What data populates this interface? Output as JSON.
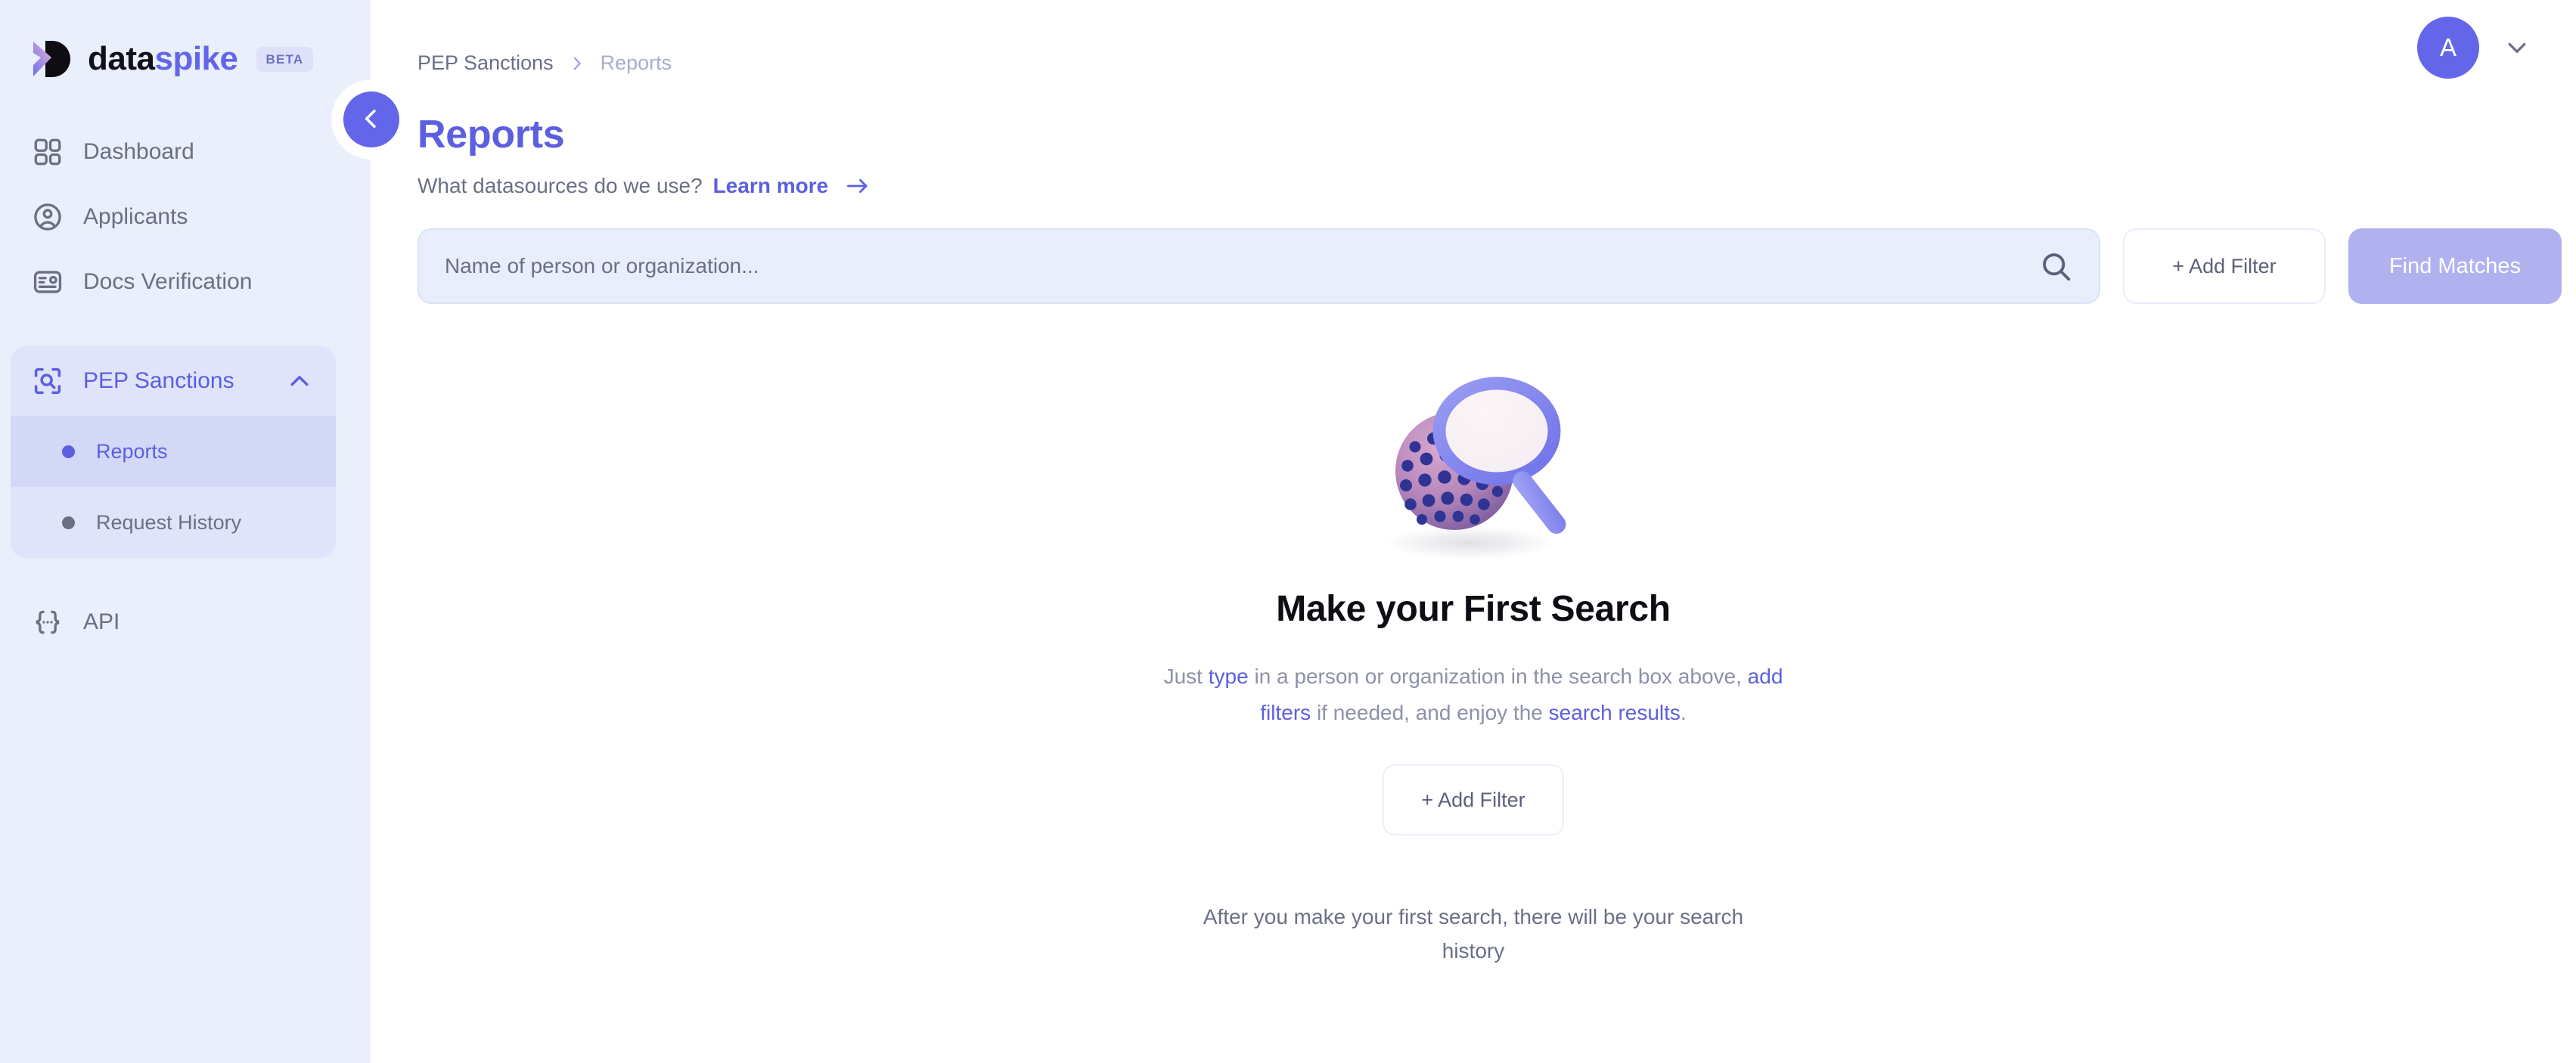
{
  "brand": {
    "name_part1": "data",
    "name_part2": "spike",
    "badge": "BETA",
    "accent": "#6366e8",
    "sidebar_bg": "#e9effb"
  },
  "sidebar": {
    "items": [
      {
        "label": "Dashboard",
        "icon": "grid-icon"
      },
      {
        "label": "Applicants",
        "icon": "user-circle-icon"
      },
      {
        "label": "Docs Verification",
        "icon": "id-card-icon"
      }
    ],
    "group": {
      "label": "PEP Sanctions",
      "icon": "scan-search-icon",
      "chevron": "chevron-up-icon",
      "expanded": true,
      "children": [
        {
          "label": "Reports",
          "active": true
        },
        {
          "label": "Request History",
          "active": false
        }
      ]
    },
    "api": {
      "label": "API",
      "icon": "braces-icon"
    },
    "collapse_button": {
      "icon": "chevron-left-icon"
    }
  },
  "topbar": {
    "breadcrumb": [
      {
        "label": "PEP Sanctions",
        "current": false
      },
      {
        "label": "Reports",
        "current": true
      }
    ],
    "breadcrumb_separator_icon": "chevron-right-icon",
    "avatar": {
      "initial": "A",
      "icon": "avatar"
    },
    "avatar_chevron_icon": "chevron-down-icon"
  },
  "page": {
    "title": "Reports",
    "subtitle_question": "What datasources do we use?",
    "subtitle_link": "Learn more",
    "subtitle_arrow_icon": "arrow-right-icon"
  },
  "search": {
    "placeholder": "Name of person or organization...",
    "value": "",
    "icon": "search-icon",
    "add_filter_label": "+  Add Filter",
    "find_matches_label": "Find Matches",
    "find_matches_enabled": false
  },
  "empty_state": {
    "illustration": "magnifier-sphere-illustration",
    "title": "Make your First Search",
    "desc_line1_a": "Just ",
    "desc_line1_hl": "type",
    "desc_line1_b": " in a person or organization in the search box above,",
    "desc_line2_hl1": "add filters",
    "desc_line2_mid": " if needed, and enjoy the ",
    "desc_line2_hl2": "search results",
    "desc_line2_end": ".",
    "add_filter_label": "+  Add Filter",
    "footer": "After you make your first search, there will be your search history"
  }
}
